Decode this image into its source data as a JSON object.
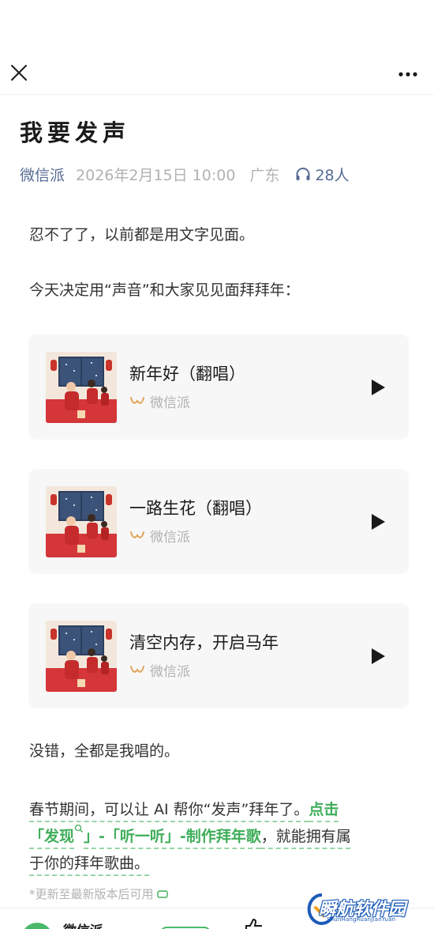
{
  "header": {
    "close_icon": "close-icon",
    "more_icon": "more-dots-icon"
  },
  "article": {
    "title": "我要发声",
    "account": "微信派",
    "date": "2026年2月15日 10:00",
    "location": "广东",
    "listeners": "28人",
    "intro1": "忍不了了，以前都是用文字见面。",
    "intro2": "今天决定用“声音”和大家见见面拜拜年："
  },
  "songs": [
    {
      "title": "新年好（翻唱）",
      "source": "微信派"
    },
    {
      "title": "一路生花（翻唱）",
      "source": "微信派"
    },
    {
      "title": "清空内存，开启马年",
      "source": "微信派"
    }
  ],
  "body": {
    "line1": "没错，全都是我唱的。",
    "p2_text1": "春节期间，可以让 AI 帮你“发声”拜年了。",
    "p2_link1": "点击",
    "p2_link2": "「发现",
    "p2_link3": "」-「听一听」-制作拜年歌",
    "p2_text2": "，就能拥有属",
    "p2_text3": "于你的拜年歌曲。",
    "note": "*更新至最新版本后可用"
  },
  "bottom": {
    "name": "微信派"
  },
  "watermark": {
    "main": "瞬航软件园",
    "sub": "ShunHangRuanJianYuan"
  },
  "colors": {
    "accent_link": "#3fae5a",
    "account_blue": "#576b95",
    "meta_gray": "#b2b2b2"
  }
}
